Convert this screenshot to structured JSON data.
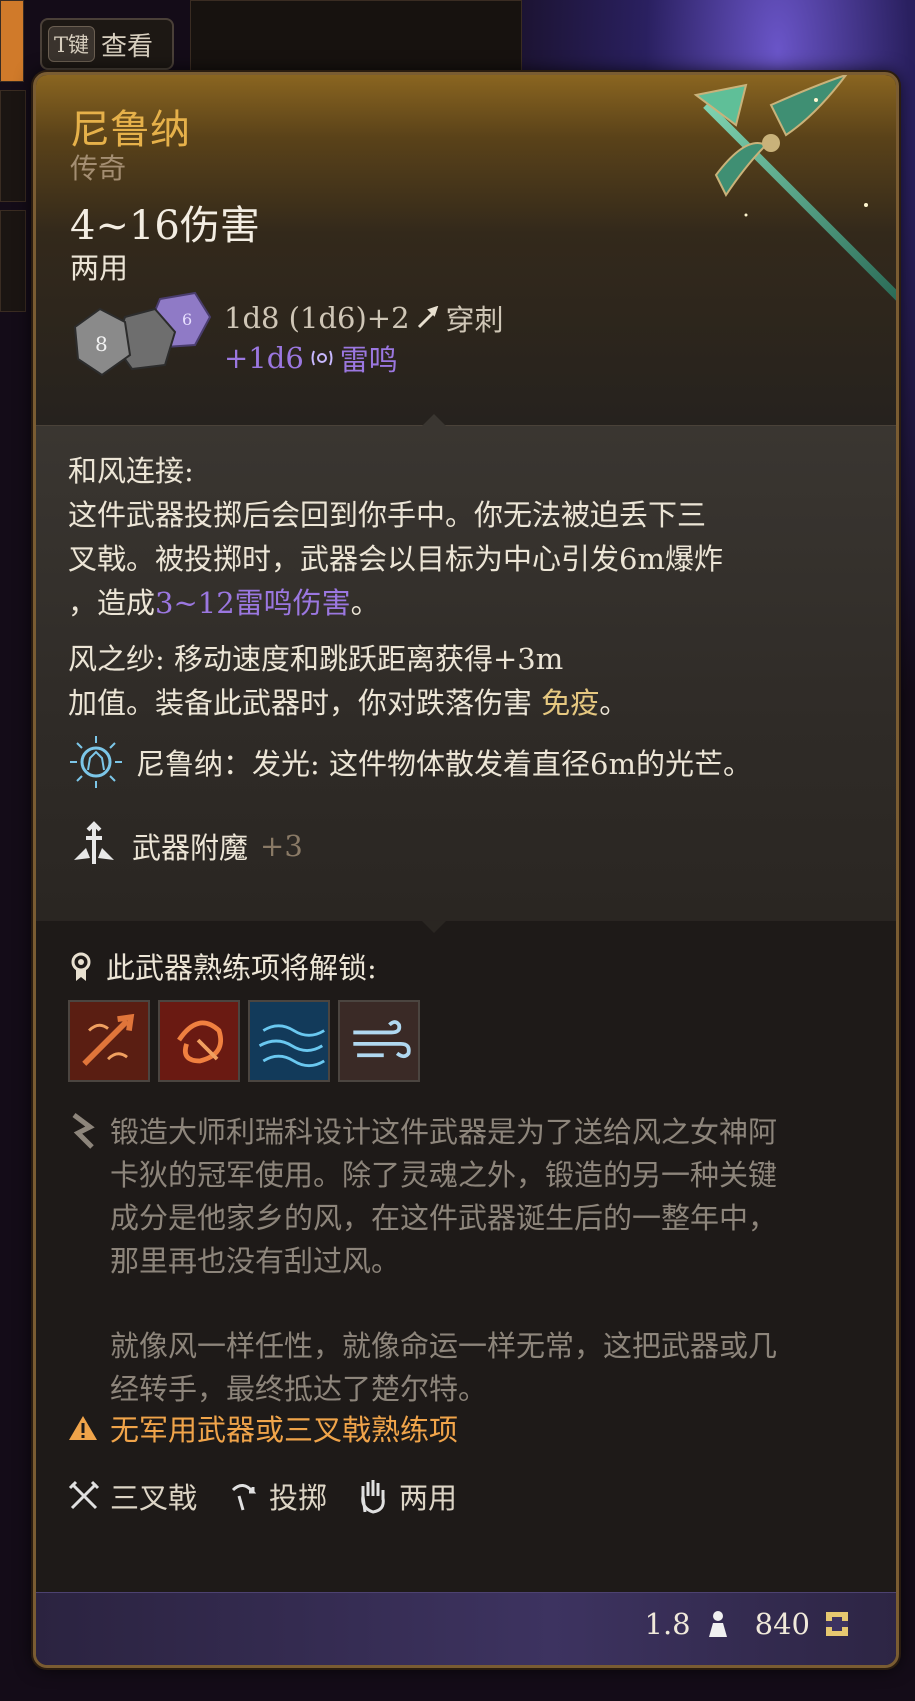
{
  "hint": {
    "key": "T键",
    "label": "查看"
  },
  "item": {
    "name": "尼鲁纳",
    "rarity": "传奇",
    "damage": "4~16伤害",
    "handedness": "两用",
    "damage_dice": "1d8 (1d6)+2",
    "damage_type": "穿刺",
    "bonus_dice": "+1d6",
    "bonus_type": "雷鸣"
  },
  "description": {
    "ability_title": "和风连接:",
    "ability_lines": [
      "这件武器投掷后会回到你手中。你无法被迫丢下三",
      "叉戟。被投掷时，武器会以目标为中心引发6m爆炸"
    ],
    "ability_line3_prefix": "，造成",
    "ability_line3_highlight": "3~12雷鸣伤害",
    "ability_line3_suffix": "。",
    "passive_line1": "风之纱: 移动速度和跳跃距离获得+3m",
    "passive_line2_prefix": "加值。装备此武器时，你对跌落伤害 ",
    "passive_line2_highlight": "免疫",
    "passive_line2_suffix": "。",
    "light_text": "尼鲁纳：发光: 这件物体散发着直径6m的光芒。",
    "enchant_label": "武器附魔",
    "enchant_value": "+3"
  },
  "proficiency": {
    "unlock_label": "此武器熟练项将解锁:",
    "icons": [
      "piercing-strike-icon",
      "cleaving-spin-icon",
      "tidal-flurry-icon",
      "wind-gust-icon"
    ]
  },
  "lore": {
    "paragraph1": [
      "锻造大师利瑞科设计这件武器是为了送给风之女神阿",
      "卡狄的冠军使用。除了灵魂之外，锻造的另一种关键",
      "成分是他家乡的风，在这件武器诞生后的一整年中，",
      "那里再也没有刮过风。"
    ],
    "paragraph2": [
      "就像风一样任性，就像命运一样无常，这把武器或几",
      "经转手，最终抵达了楚尔特。"
    ]
  },
  "warning": "无军用武器或三叉戟熟练项",
  "tags": {
    "weapon_type": "三叉戟",
    "thrown": "投掷",
    "versatile": "两用"
  },
  "footer": {
    "weight": "1.8",
    "price": "840"
  },
  "colors": {
    "name": "#e6b14a",
    "thunder": "#9b77e0",
    "warning": "#f0a44a"
  }
}
